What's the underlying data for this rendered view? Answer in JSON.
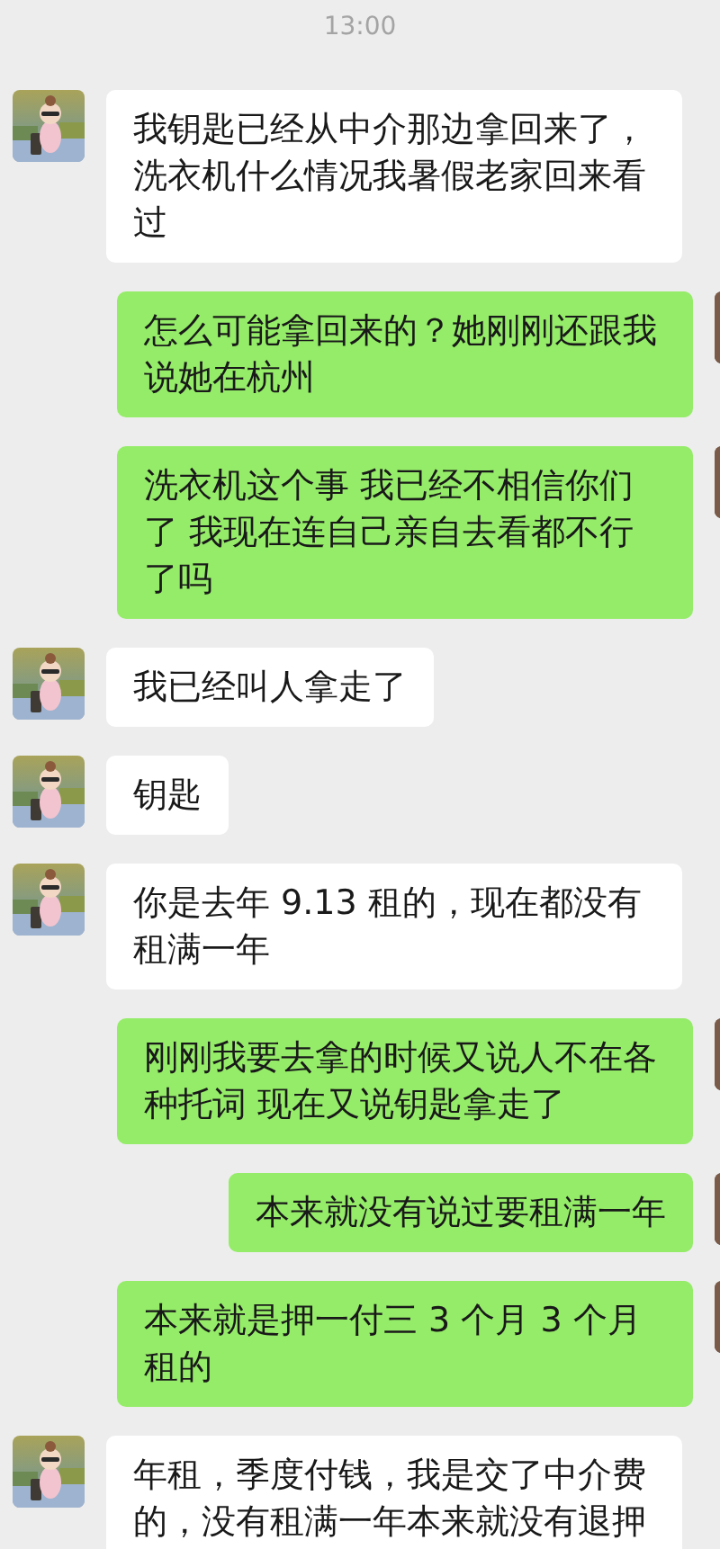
{
  "time": "13:00",
  "messages": [
    {
      "kind": "received",
      "text": "我钥匙已经从中介那边拿回来了，洗衣机什么情况我暑假老家回来看过"
    },
    {
      "kind": "sent",
      "text": "怎么可能拿回来的？她刚刚还跟我说她在杭州"
    },
    {
      "kind": "sent",
      "text": "洗衣机这个事 我已经不相信你们了 我现在连自己亲自去看都不行了吗"
    },
    {
      "kind": "received",
      "text": "我已经叫人拿走了"
    },
    {
      "kind": "received",
      "text": "钥匙"
    },
    {
      "kind": "received",
      "text": "你是去年 9.13 租的，现在都没有租满一年"
    },
    {
      "kind": "sent",
      "text": "刚刚我要去拿的时候又说人不在各种托词 现在又说钥匙拿走了"
    },
    {
      "kind": "sent",
      "text": "本来就没有说过要租满一年"
    },
    {
      "kind": "sent",
      "text": "本来就是押一付三 3 个月 3 个月租的"
    },
    {
      "kind": "received",
      "text": "年租，季度付钱，我是交了中介费的，没有租满一年本来就没有退押"
    }
  ]
}
